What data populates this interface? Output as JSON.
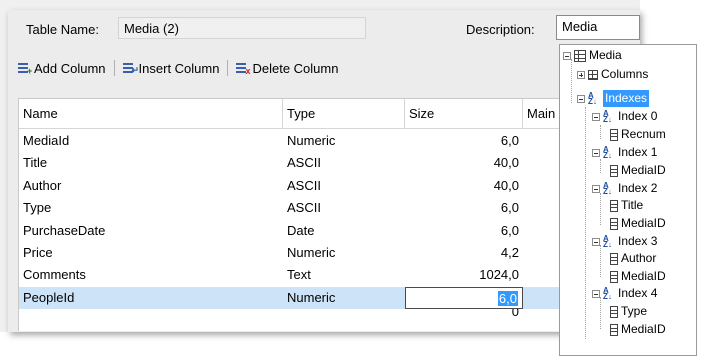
{
  "form": {
    "table_name_label": "Table Name:",
    "table_name_value": "Media (2)",
    "description_label": "Description:",
    "description_value": "Media"
  },
  "toolbar": {
    "add_column": "Add Column",
    "insert_column": "Insert Column",
    "delete_column": "Delete Column"
  },
  "grid": {
    "headers": [
      "Name",
      "Type",
      "Size",
      "Main"
    ],
    "rows": [
      {
        "name": "MediaId",
        "type": "Numeric",
        "size": "6,0"
      },
      {
        "name": "Title",
        "type": "ASCII",
        "size": "40,0"
      },
      {
        "name": "Author",
        "type": "ASCII",
        "size": "40,0"
      },
      {
        "name": "Type",
        "type": "ASCII",
        "size": "6,0"
      },
      {
        "name": "PurchaseDate",
        "type": "Date",
        "size": "6,0"
      },
      {
        "name": "Price",
        "type": "Numeric",
        "size": "4,2"
      },
      {
        "name": "Comments",
        "type": "Text",
        "size": "1024,0"
      },
      {
        "name": "PeopleId",
        "type": "Numeric",
        "size": "6,0"
      }
    ],
    "partial_next_size": "0"
  },
  "tree": {
    "root": "Media",
    "columns": "Columns",
    "indexes": "Indexes",
    "index0": "Index 0",
    "index0_fields": [
      "Recnum"
    ],
    "index1": "Index 1",
    "index1_fields": [
      "MediaID"
    ],
    "index2": "Index 2",
    "index2_fields": [
      "Title",
      "MediaID"
    ],
    "index3": "Index 3",
    "index3_fields": [
      "Author",
      "MediaID"
    ],
    "index4": "Index 4",
    "index4_fields": [
      "Type",
      "MediaID"
    ]
  },
  "colors": {
    "selection_blue": "#3399ff",
    "row_highlight": "#cde3f7",
    "panel_bg": "#f0f0f0"
  },
  "icons": [
    "add-column-icon",
    "insert-column-icon",
    "delete-column-icon",
    "table-icon",
    "columns-icon",
    "index-sort-icon",
    "field-icon"
  ]
}
